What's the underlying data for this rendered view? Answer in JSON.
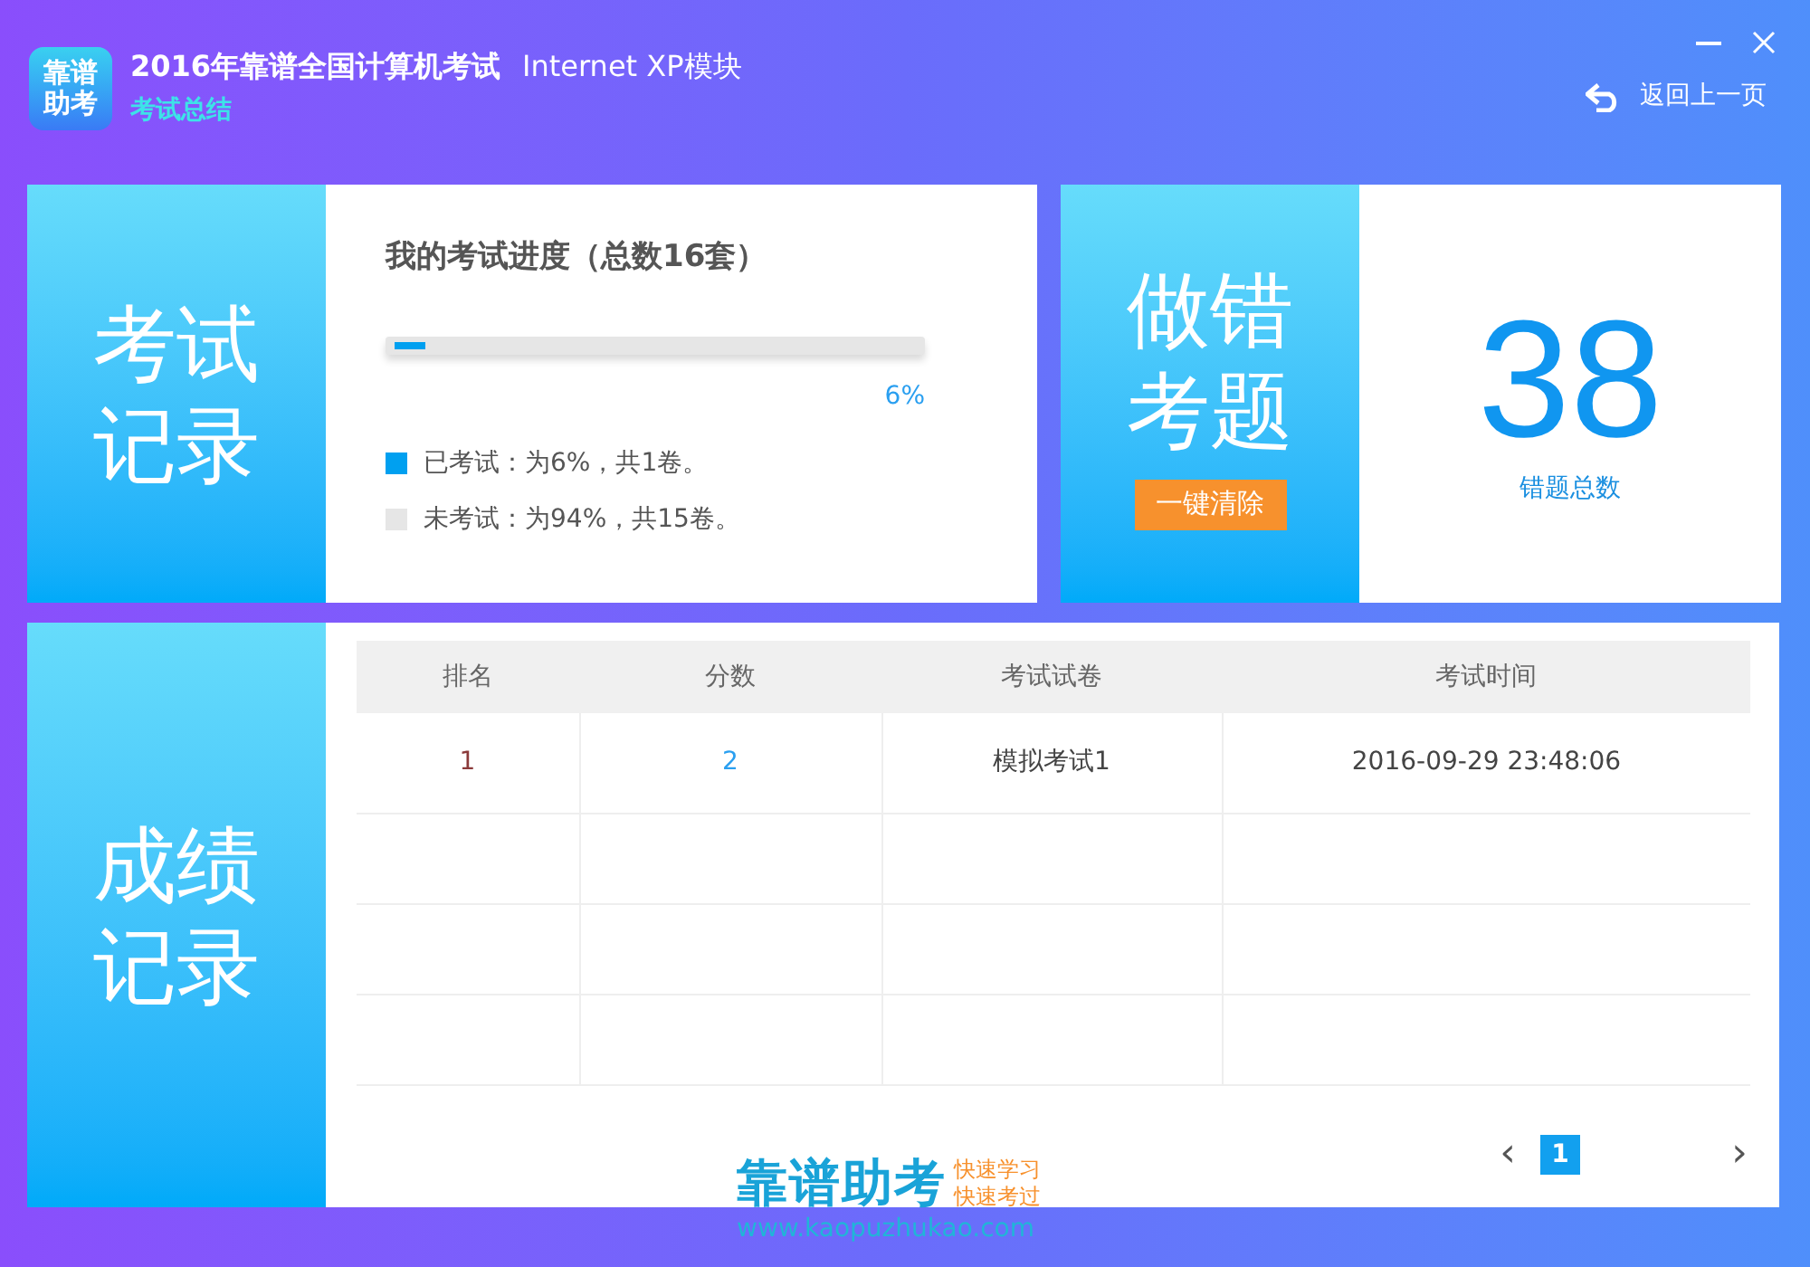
{
  "header": {
    "logo_text": [
      "靠谱",
      "助考"
    ],
    "title": "2016年靠谱全国计算机考试",
    "module": "Internet XP模块",
    "subtitle": "考试总结",
    "back": "返回上一页"
  },
  "exam_record": {
    "label": [
      "考试",
      "记录"
    ],
    "heading": "我的考试进度（总数16套）",
    "progress": {
      "level": 0.06,
      "reading": "6%"
    },
    "legend": [
      {
        "text": "已考试：为6%，共1卷。",
        "color": "#00a0f0"
      },
      {
        "text": "未考试：为94%，共15卷。",
        "color": "#e6e6e6"
      }
    ]
  },
  "wrong": {
    "label": [
      "做错",
      "考题"
    ],
    "clear_button": "一键清除",
    "count": "38",
    "count_label": "错题总数"
  },
  "scores": {
    "label": [
      "成绩",
      "记录"
    ],
    "columns": [
      "排名",
      "分数",
      "考试试卷",
      "考试时间"
    ],
    "rows": [
      [
        "1",
        "2",
        "模拟考试1",
        "2016-09-29 23:48:06"
      ],
      [
        "",
        "",
        "",
        ""
      ],
      [
        "",
        "",
        "",
        ""
      ],
      [
        "",
        "",
        "",
        ""
      ]
    ],
    "pagination": {
      "prev": "‹",
      "pages": [
        {
          "label": "1",
          "selected": true
        }
      ],
      "next": "›"
    }
  },
  "brand": {
    "name": "靠谱助考",
    "slogan": [
      "快速学习",
      "快速考过"
    ],
    "url": "www.kaopuzhukao.com"
  }
}
